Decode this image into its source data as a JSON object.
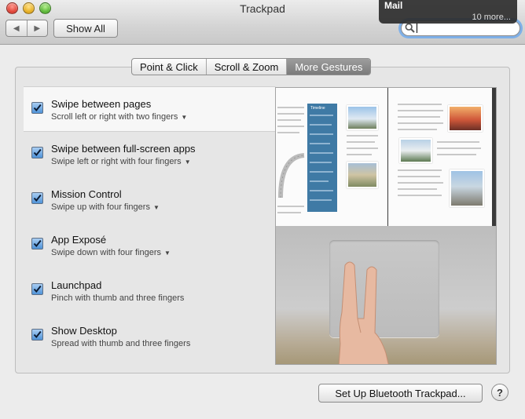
{
  "window": {
    "title": "Trackpad"
  },
  "toolbar": {
    "back_icon": "back-triangle",
    "forward_icon": "forward-triangle",
    "show_all": "Show All"
  },
  "notification": {
    "app": "Mail",
    "more": "10 more..."
  },
  "tabs": [
    {
      "label": "Point & Click",
      "active": false
    },
    {
      "label": "Scroll & Zoom",
      "active": false
    },
    {
      "label": "More Gestures",
      "active": true
    }
  ],
  "gestures": [
    {
      "title": "Swipe between pages",
      "subtitle": "Scroll left or right with two fingers",
      "checked": true,
      "has_menu": true,
      "selected": true
    },
    {
      "title": "Swipe between full-screen apps",
      "subtitle": "Swipe left or right with four fingers",
      "checked": true,
      "has_menu": true
    },
    {
      "title": "Mission Control",
      "subtitle": "Swipe up with four fingers",
      "checked": true,
      "has_menu": true
    },
    {
      "title": "App Exposé",
      "subtitle": "Swipe down with four fingers",
      "checked": true,
      "has_menu": true
    },
    {
      "title": "Launchpad",
      "subtitle": "Pinch with thumb and three fingers",
      "checked": true,
      "has_menu": false
    },
    {
      "title": "Show Desktop",
      "subtitle": "Spread with thumb and three fingers",
      "checked": true,
      "has_menu": false
    }
  ],
  "preview": {
    "book_heading": "Timeline"
  },
  "footer": {
    "bluetooth_button": "Set Up Bluetooth Trackpad...",
    "help": "?"
  },
  "colors": {
    "accent": "#4f93d8",
    "tab_active": "#8a8a8a",
    "focus_ring": "#7fb0e8"
  }
}
